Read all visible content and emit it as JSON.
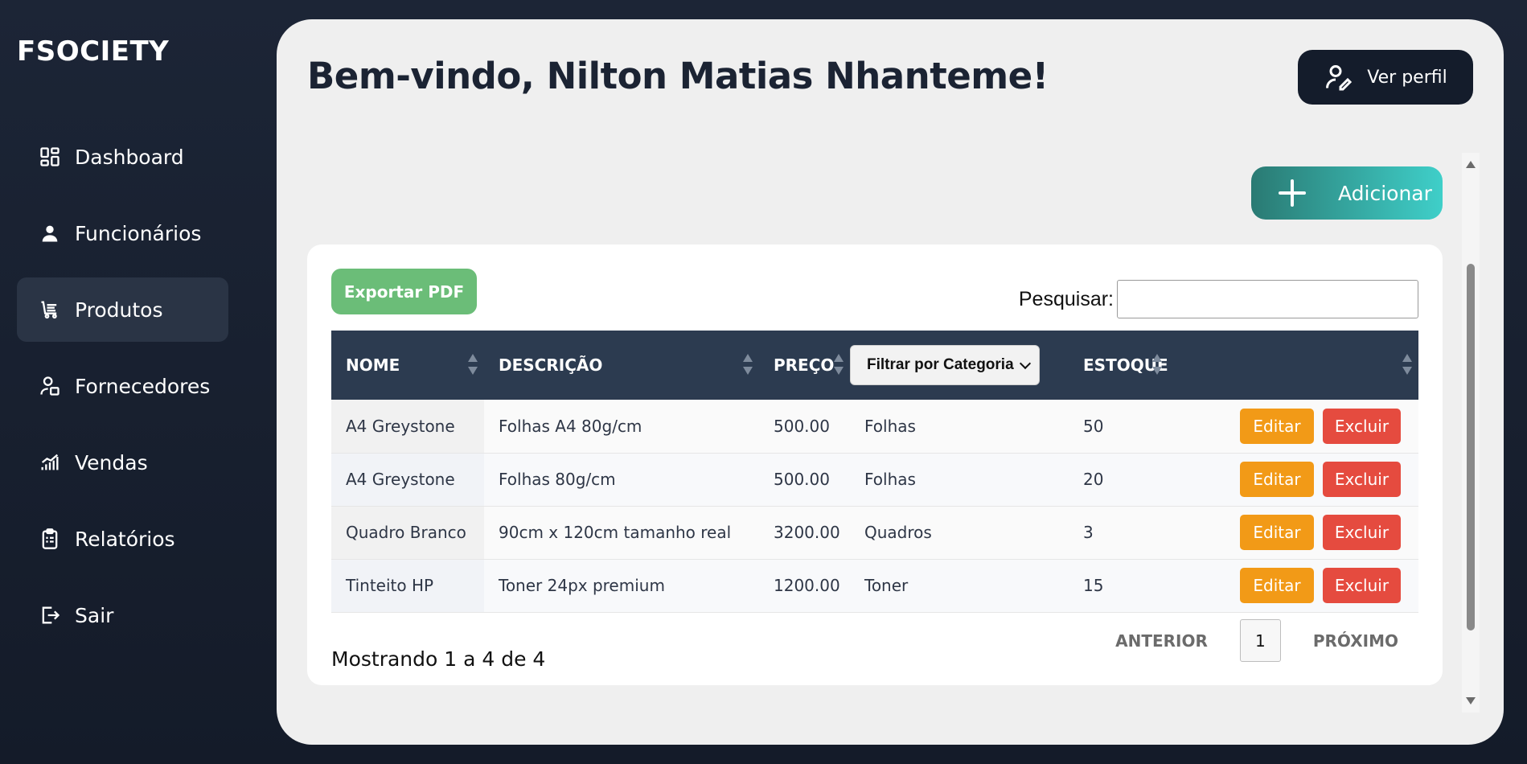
{
  "brand": "FSOCIETY",
  "sidebar": {
    "items": [
      {
        "label": "Dashboard",
        "icon": "dashboard-icon"
      },
      {
        "label": "Funcionários",
        "icon": "user-icon"
      },
      {
        "label": "Produtos",
        "icon": "cart-icon",
        "active": true
      },
      {
        "label": "Fornecedores",
        "icon": "supplier-icon"
      },
      {
        "label": "Vendas",
        "icon": "sales-chart-icon"
      },
      {
        "label": "Relatórios",
        "icon": "clipboard-icon"
      },
      {
        "label": "Sair",
        "icon": "logout-icon"
      }
    ]
  },
  "header": {
    "welcome": "Bem-vindo, Nilton Matias Nhanteme!",
    "profile_label": "Ver perfil"
  },
  "toolbar": {
    "add_label": "Adicionar",
    "export_label": "Exportar PDF",
    "search_label": "Pesquisar:",
    "search_value": ""
  },
  "table": {
    "headers": [
      "NOME",
      "DESCRIÇÃO",
      "PREÇO",
      "Filtrar por Categoria",
      "ESTOQUE"
    ],
    "rows": [
      {
        "nome": "A4 Greystone",
        "descricao": "Folhas A4 80g/cm",
        "preco": "500.00",
        "categoria": "Folhas",
        "estoque": "50"
      },
      {
        "nome": "A4 Greystone",
        "descricao": "Folhas 80g/cm",
        "preco": "500.00",
        "categoria": "Folhas",
        "estoque": "20"
      },
      {
        "nome": "Quadro Branco",
        "descricao": "90cm x 120cm tamanho real",
        "preco": "3200.00",
        "categoria": "Quadros",
        "estoque": "3"
      },
      {
        "nome": "Tinteito HP",
        "descricao": "Toner 24px premium",
        "preco": "1200.00",
        "categoria": "Toner",
        "estoque": "15"
      }
    ],
    "edit_label": "Editar",
    "delete_label": "Excluir"
  },
  "pagination": {
    "info": "Mostrando 1 a 4 de 4",
    "prev": "ANTERIOR",
    "current": "1",
    "next": "PRÓXIMO"
  },
  "colors": {
    "sidebar_bg": "#1c2536",
    "header_dark": "#2c3b50",
    "edit": "#f29a17",
    "delete": "#e54b3f",
    "export": "#6bbd78",
    "add_from": "#2a7a73",
    "add_to": "#3fcfc9"
  }
}
